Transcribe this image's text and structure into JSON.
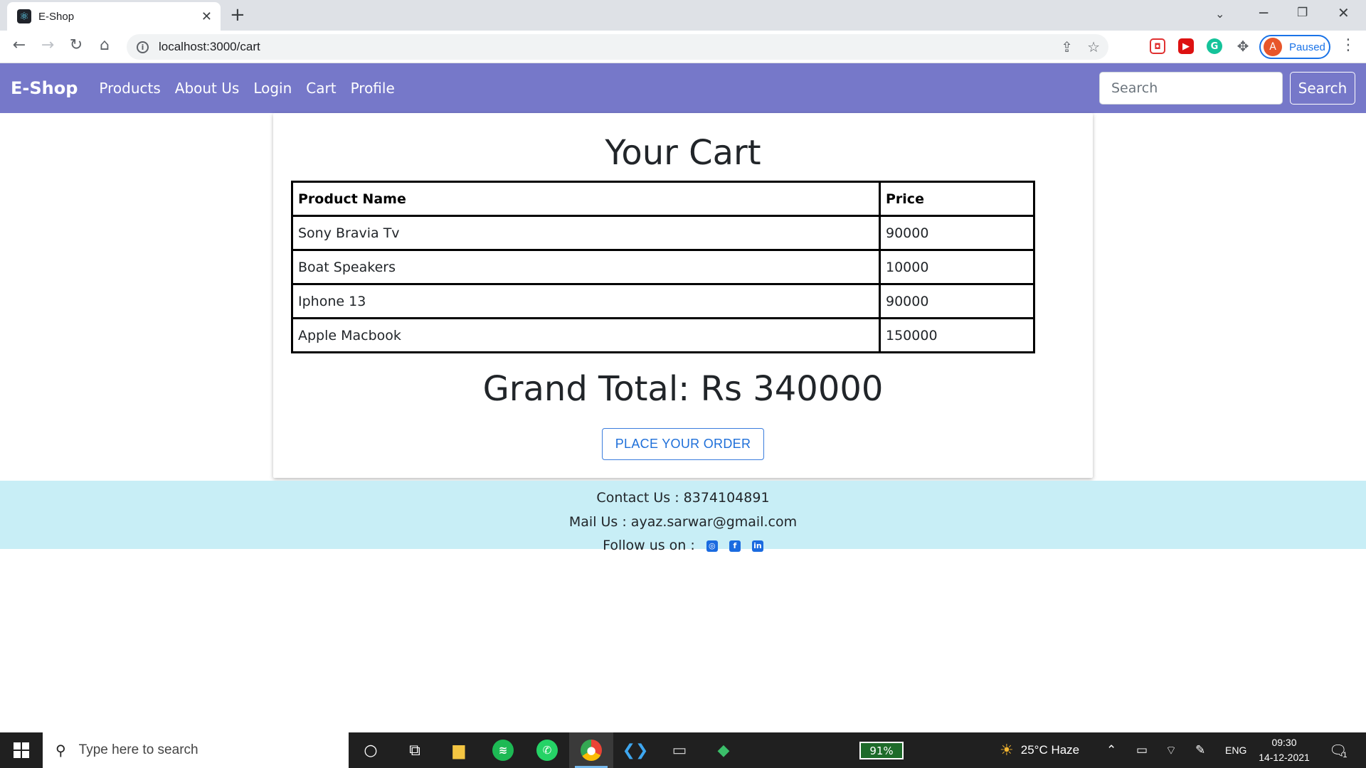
{
  "browser": {
    "tab_title": "E-Shop",
    "tab_close": "✕",
    "new_tab": "+",
    "url": "localhost:3000/cart",
    "profile_initial": "A",
    "profile_status": "Paused"
  },
  "navbar": {
    "brand": "E-Shop",
    "links": [
      "Products",
      "About Us",
      "Login",
      "Cart",
      "Profile"
    ],
    "search_placeholder": "Search",
    "search_button": "Search",
    "bg_color": "#7678c9"
  },
  "cart": {
    "title": "Your Cart",
    "columns": [
      "Product Name",
      "Price"
    ],
    "rows": [
      {
        "name": "Sony Bravia Tv",
        "price": "90000"
      },
      {
        "name": "Boat Speakers",
        "price": "10000"
      },
      {
        "name": "Iphone 13",
        "price": "90000"
      },
      {
        "name": "Apple Macbook",
        "price": "150000"
      }
    ],
    "grand_total": "Grand Total: Rs 340000",
    "order_button": "PLACE YOUR ORDER"
  },
  "footer": {
    "contact": "Contact Us : 8374104891",
    "mail": "Mail Us : ayaz.sarwar@gmail.com",
    "follow": "Follow us on :",
    "social_icons": [
      "instagram-icon",
      "facebook-icon",
      "linkedin-icon"
    ],
    "bg_color": "#c8eef6"
  },
  "taskbar": {
    "search_placeholder": "Type here to search",
    "battery": "91%",
    "weather": "25°C  Haze",
    "language": "ENG",
    "time": "09:30",
    "date": "14-12-2021",
    "notification_count": "1"
  }
}
